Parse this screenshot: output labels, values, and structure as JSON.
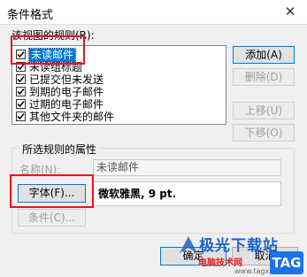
{
  "window": {
    "title": "条件格式",
    "close_glyph": "✕"
  },
  "rules_section": {
    "label": "该视图的规则(R):",
    "items": [
      {
        "label": "未读邮件",
        "checked": true,
        "selected": true
      },
      {
        "label": "未读组标题",
        "checked": true
      },
      {
        "label": "已提交但未发送",
        "checked": true
      },
      {
        "label": "到期的电子邮件",
        "checked": true
      },
      {
        "label": "过期的电子邮件",
        "checked": true
      },
      {
        "label": "其他文件夹的邮件",
        "checked": true
      }
    ]
  },
  "buttons": {
    "add": "添加(A)",
    "delete": "删除(D)",
    "move_up": "上移(U)",
    "move_down": "下移(O)",
    "ok": "确定",
    "cancel": "取消"
  },
  "properties": {
    "label": "所选规则的属性",
    "name_label": "名称(N):",
    "name_value": "未读邮件",
    "font_button": "字体(F)...",
    "font_value": "微软雅黑, 9 pt.",
    "condition_button": "条件(C)..."
  },
  "watermark": {
    "brand": "极光下载站",
    "sub": "电脑技术网",
    "url": "www.tagxp.com",
    "tag": "TAG"
  },
  "colors": {
    "highlight_red": "#e8151e",
    "selection_blue": "#0078d7",
    "brand_blue": "#1e63c8"
  }
}
